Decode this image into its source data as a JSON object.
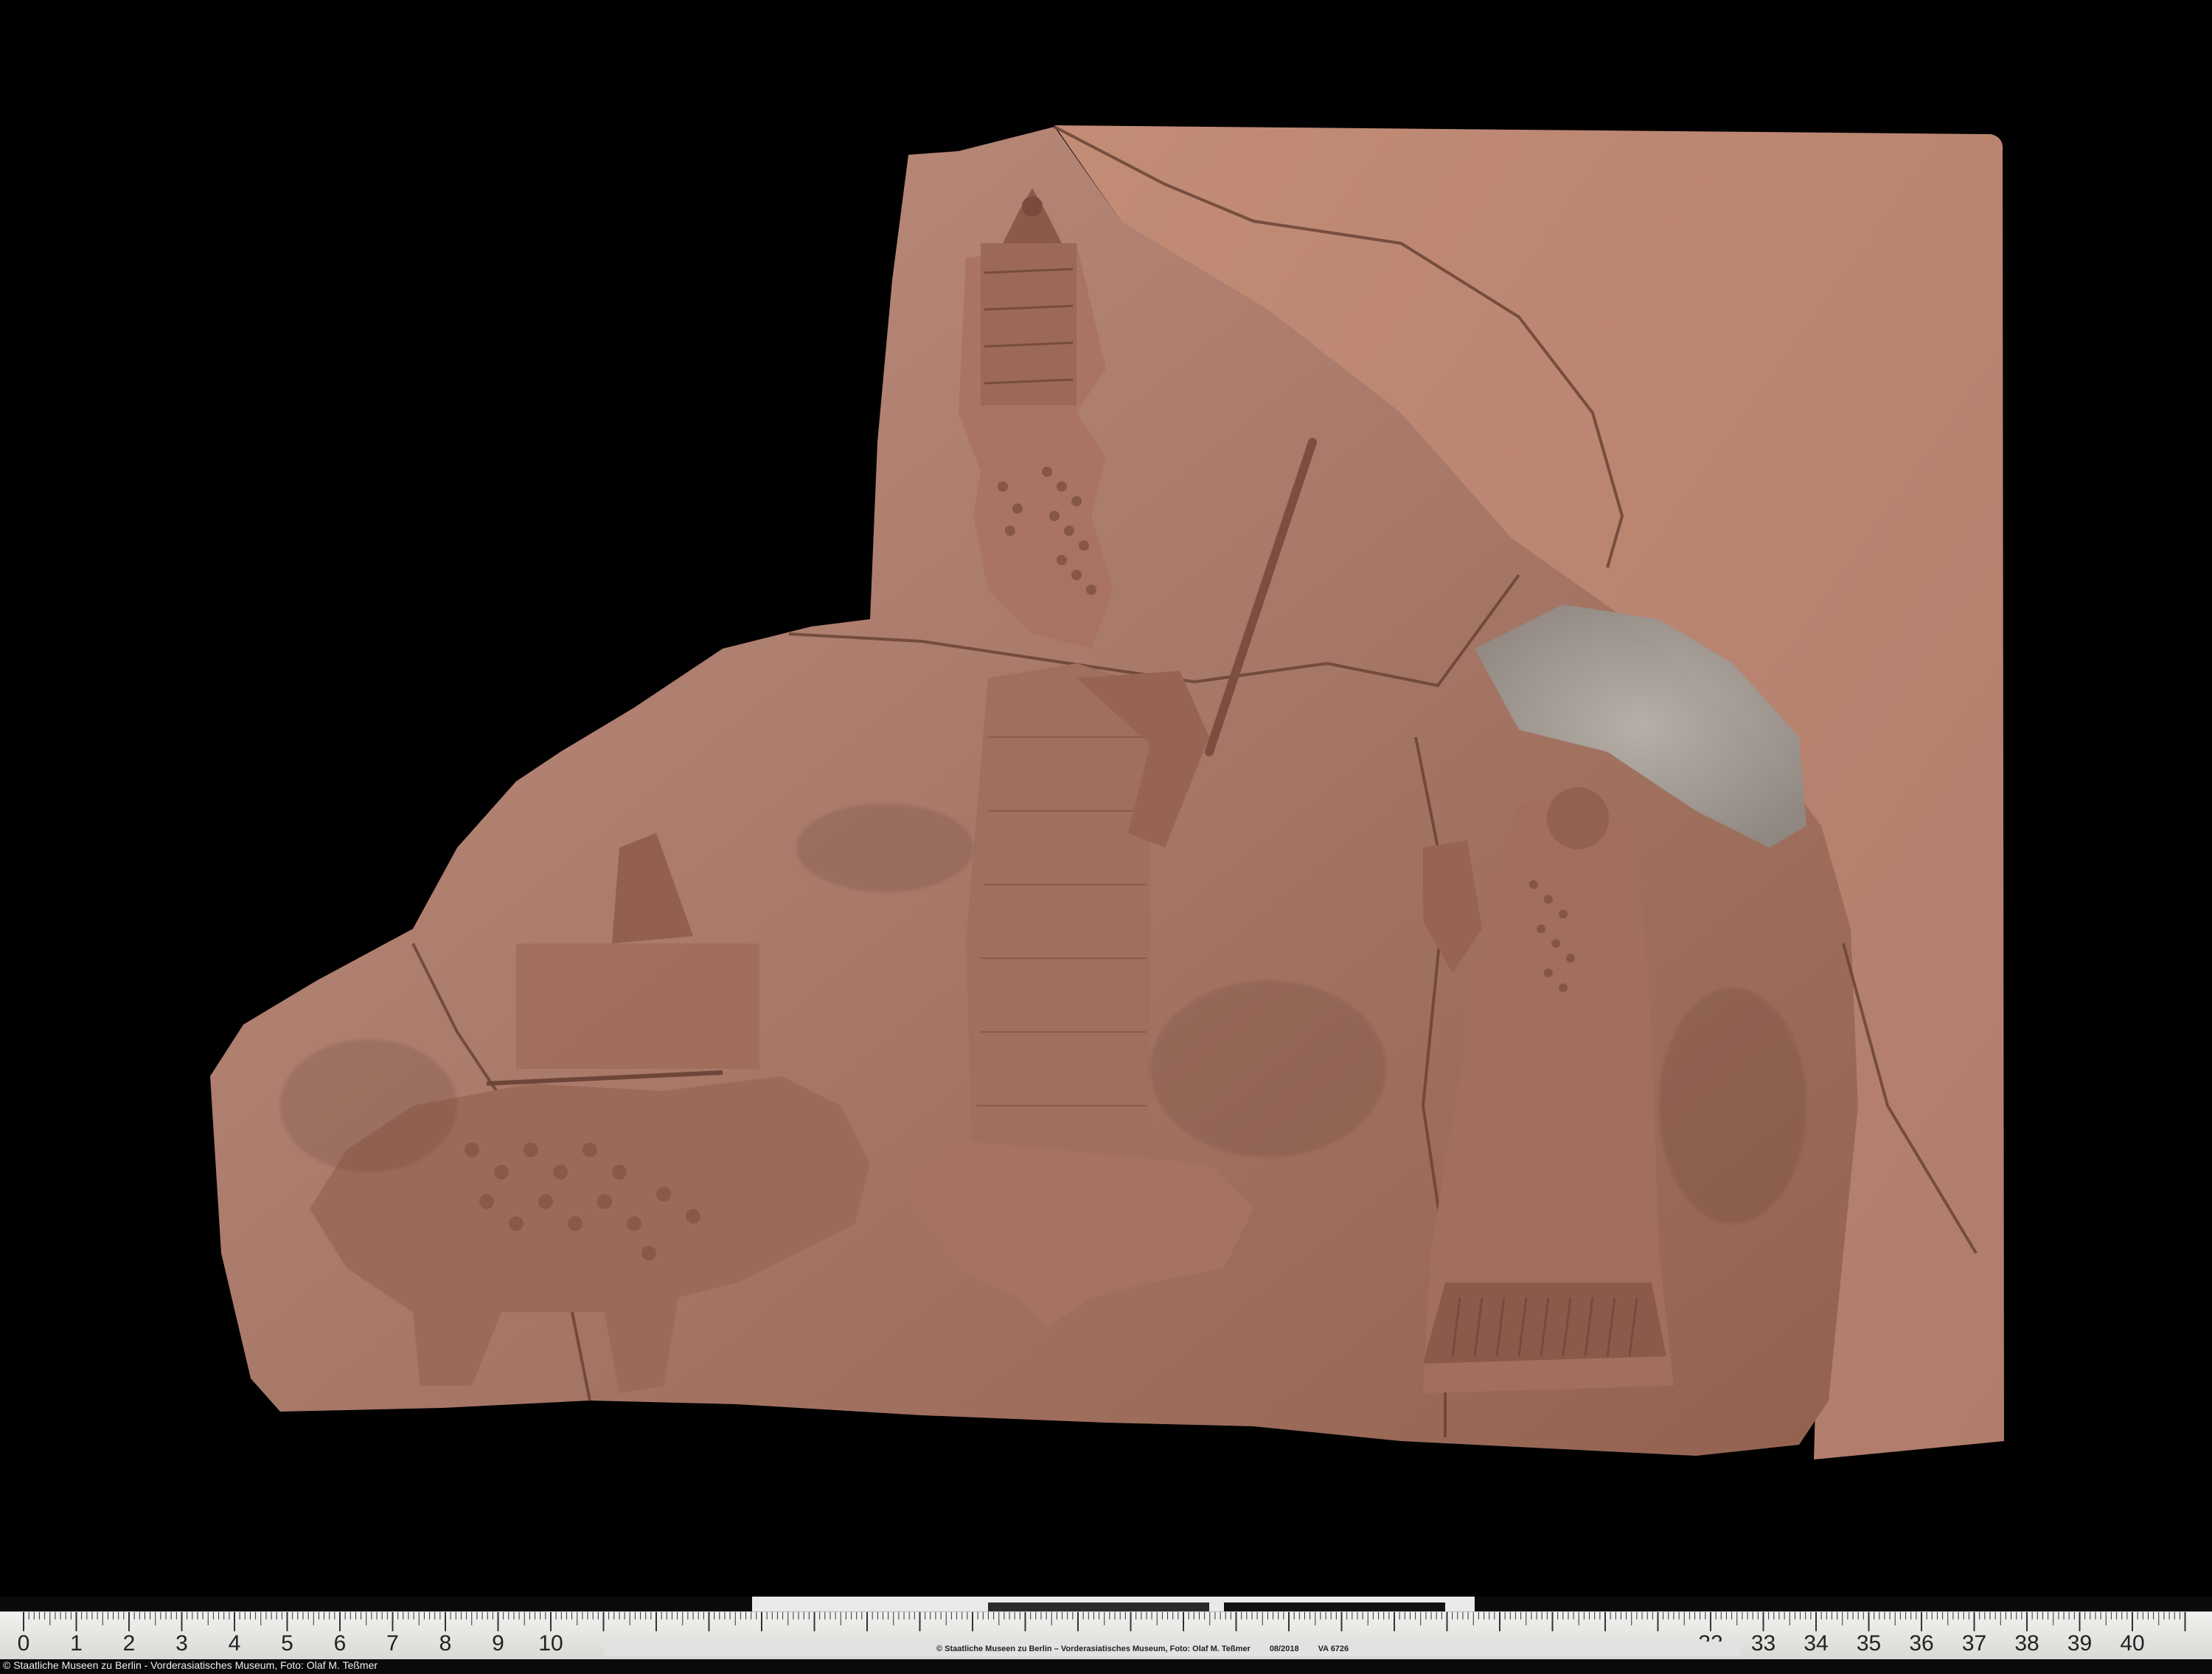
{
  "photo": {
    "subject": "terracotta-relief-fragment",
    "colors": {
      "background": "#000000",
      "clay_light": "#b98774",
      "clay_mid": "#a06f5d",
      "clay_dark": "#6e4639",
      "encrustation": "#a4a39c"
    }
  },
  "ruler": {
    "left_numbers": [
      "0",
      "1",
      "2",
      "3",
      "4",
      "5",
      "6",
      "7",
      "8",
      "9",
      "10"
    ],
    "right_numbers": [
      "32",
      "33",
      "34",
      "35",
      "36",
      "37",
      "38",
      "39",
      "40"
    ],
    "label_text": "© Staatliche Museen zu Berlin – Vorderasiatisches Museum, Foto: Olaf M. Teßmer",
    "label_date": "08/2018",
    "label_id": "VA 6726"
  },
  "credit": "© Staatliche Museen zu Berlin - Vorderasiatisches Museum, Foto: Olaf M. Teßmer"
}
